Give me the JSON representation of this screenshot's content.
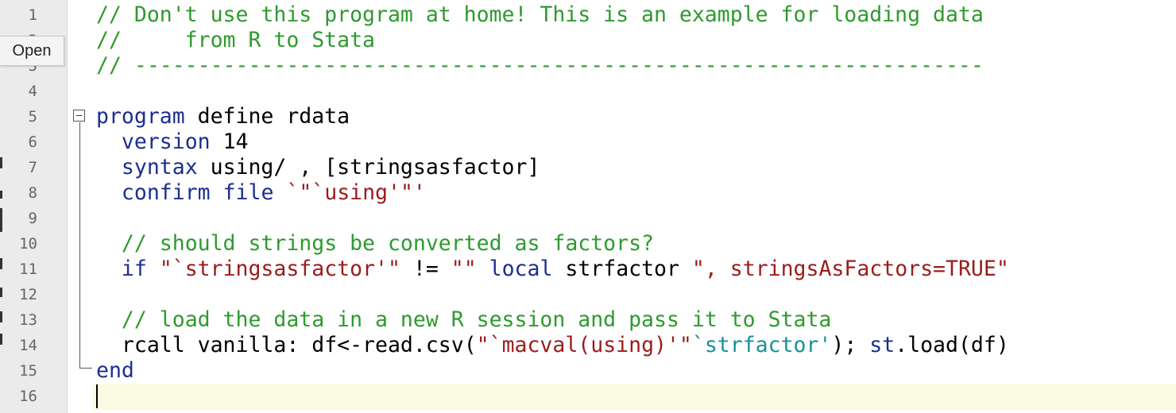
{
  "editor": {
    "tooltip": "Open",
    "line_numbers": [
      "1",
      "2",
      "3",
      "4",
      "5",
      "6",
      "7",
      "8",
      "9",
      "10",
      "11",
      "12",
      "13",
      "14",
      "15",
      "16"
    ],
    "code": {
      "l1": "// Don't use this program at home! This is an example for loading data",
      "l2": "//     from R to Stata",
      "l3": "// -------------------------------------------------------------------",
      "l5_kw": "program",
      "l5_rest": " define rdata",
      "l6_indent": "  ",
      "l6_kw": "version",
      "l6_rest": " 14",
      "l7_kw": "syntax",
      "l7_rest": " using/ , [stringsasfactor]",
      "l8_kw1": "confirm",
      "l8_sp": " ",
      "l8_kw2": "file",
      "l8_sp2": " ",
      "l8_str": "`\"`using'\"'",
      "l10_cm": "// should strings be converted as factors?",
      "l11_kw": "if",
      "l11_str1": " \"`stringsasfactor'\"",
      "l11_op": " != ",
      "l11_str2": "\"\"",
      "l11_kw2": " local",
      "l11_mid": " strfactor ",
      "l11_str3": "\", stringsAsFactors=TRUE\"",
      "l13_cm": "// load the data in a new R session and pass it to Stata",
      "l14_a": "rcall vanilla: df<-read.csv(",
      "l14_str": "\"`macval(using)'\"",
      "l14_mc": "`strfactor'",
      "l14_b": "); ",
      "l14_kw": "st",
      "l14_c": ".load(df)",
      "l15_kw": "end"
    }
  },
  "colors": {
    "comment": "#2e9a2e",
    "keyword": "#1c2e8f",
    "string": "#9b1c1c",
    "macro": "#1a8f9a",
    "current_line": "#fbfbe3",
    "gutter": "#ebebeb"
  }
}
